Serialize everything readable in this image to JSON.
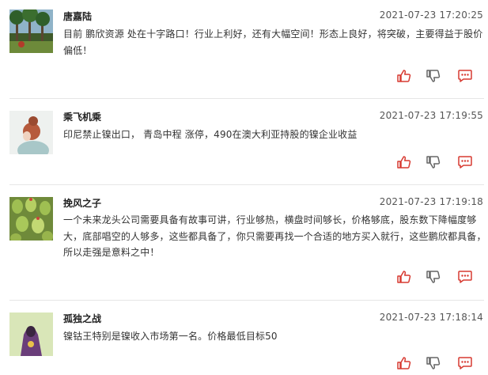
{
  "colors": {
    "accent": "#d73a31",
    "icon_gray": "#666666",
    "divider": "#e6e6e6"
  },
  "comments": [
    {
      "username": "唐嘉陆",
      "time": "2021-07-23 17:20:25",
      "text": "目前 鹏欣资源 处在十字路口！行业上利好，还有大幅空间！形态上良好，将突破，主要得益于股价偏低！",
      "avatar": "palm-trees-photo"
    },
    {
      "username": "乘飞机乘",
      "time": "2021-07-23 17:19:55",
      "text": "印尼禁止镍出口， 青岛中程 涨停，490在澳大利亚持股的镍企业收益",
      "avatar": "woman-bun-photo"
    },
    {
      "username": "挽风之子",
      "time": "2021-07-23 17:19:18",
      "text": "一个未来龙头公司需要具备有故事可讲，行业够热，横盘时间够长，价格够底，股东数下降幅度够大，底部唱空的人够多，这些都具备了，你只需要再找一个合适的地方买入就行，这些鹏欣都具备，所以走强是意料之中！",
      "avatar": "succulents-photo"
    },
    {
      "username": "孤独之战",
      "time": "2021-07-23 17:18:14",
      "text": "镍钴王特别是镍收入市场第一名。价格最低目标50",
      "avatar": "hooded-figure-photo"
    }
  ]
}
